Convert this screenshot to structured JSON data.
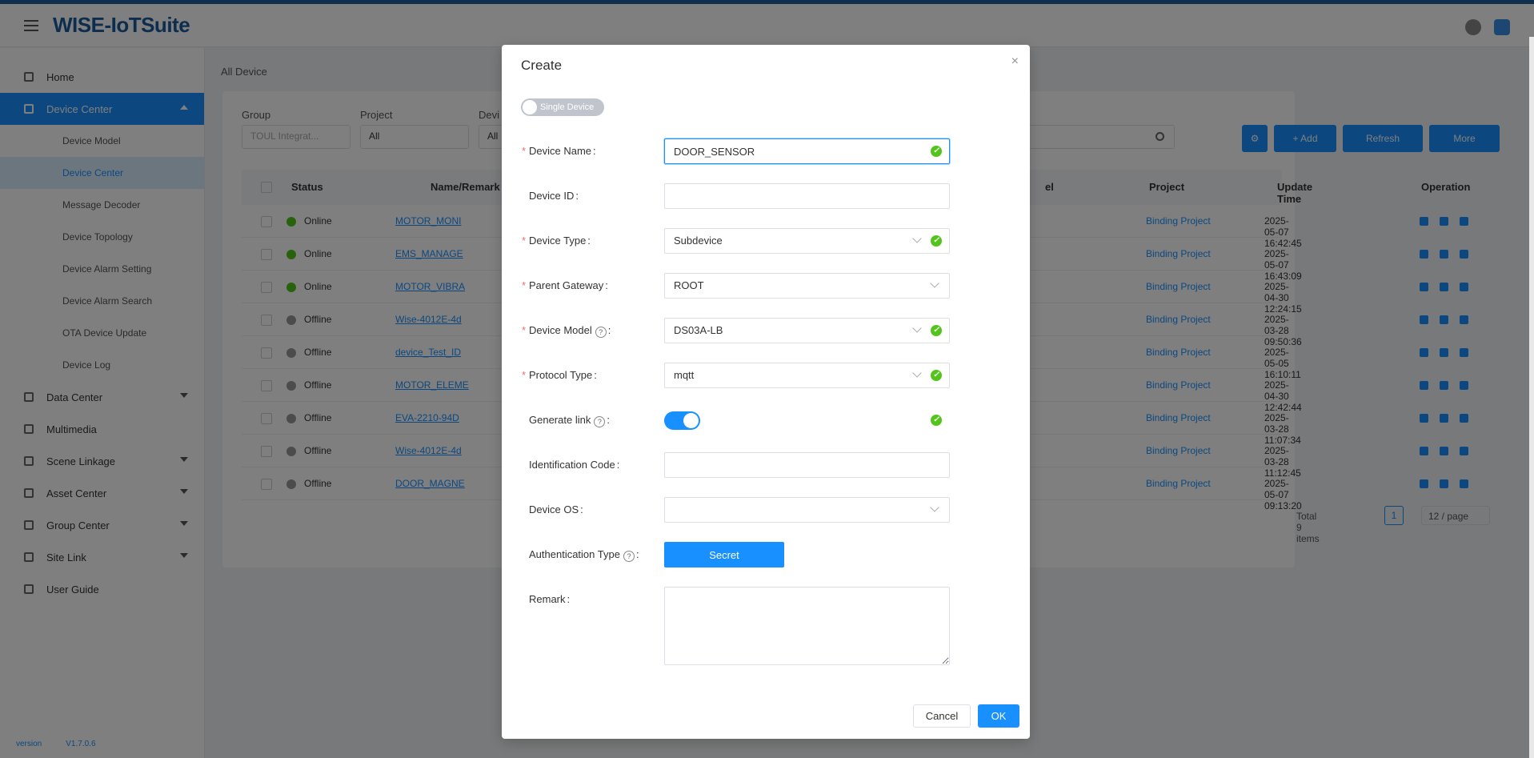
{
  "app": {
    "logo": "WISE-IoTSuite",
    "version": [
      "version",
      "V1.7.0.6"
    ]
  },
  "sidebar": {
    "items": [
      {
        "label": "Home",
        "icon": "home-icon"
      },
      {
        "label": "Device Center",
        "icon": "device-icon",
        "active": true
      },
      {
        "label": "Data Center",
        "icon": "data-icon"
      },
      {
        "label": "Multimedia",
        "icon": "multimedia-icon"
      },
      {
        "label": "Scene Linkage",
        "icon": "scene-icon"
      },
      {
        "label": "Asset Center",
        "icon": "asset-icon"
      },
      {
        "label": "Group Center",
        "icon": "group-icon"
      },
      {
        "label": "Site Link",
        "icon": "link-icon"
      },
      {
        "label": "User Guide",
        "icon": "guide-icon"
      }
    ],
    "sub_items": [
      "Device Model",
      "Device Center",
      "Message Decoder",
      "Device Topology",
      "Device Alarm Setting",
      "Device Alarm Search",
      "OTA Device Update",
      "Device Log"
    ]
  },
  "breadcrumb": "All Device",
  "filters": {
    "group_label": "Group",
    "group_placeholder": "TOUL Integrat...",
    "project_label": "Project",
    "project_value": "All",
    "device_label": "Devi",
    "device_value": "All"
  },
  "toolbar": {
    "add": "+ Add",
    "refresh": "Refresh",
    "more": "More"
  },
  "table": {
    "headers": {
      "status": "Status",
      "name": "Name/Remark",
      "model": "el",
      "project": "Project",
      "update_time": "Update Time",
      "operation": "Operation"
    },
    "rows": [
      {
        "status": "Online",
        "name": "MOTOR_MONI",
        "project": "Binding Project",
        "time": "2025-05-07 16:42:45"
      },
      {
        "status": "Online",
        "name": "EMS_MANAGE",
        "project": "Binding Project",
        "time": "2025-05-07 16:43:09"
      },
      {
        "status": "Online",
        "name": "MOTOR_VIBRA",
        "project": "Binding Project",
        "time": "2025-04-30 12:24:15"
      },
      {
        "status": "Offline",
        "name": "Wise-4012E-4d",
        "project": "Binding Project",
        "time": "2025-03-28 09:50:36"
      },
      {
        "status": "Offline",
        "name": "device_Test_ID",
        "project": "Binding Project",
        "time": "2025-05-05 16:10:11"
      },
      {
        "status": "Offline",
        "name": "MOTOR_ELEME",
        "project": "Binding Project",
        "time": "2025-04-30 12:42:44"
      },
      {
        "status": "Offline",
        "name": "EVA-2210-94D",
        "project": "Binding Project",
        "time": "2025-03-28 11:07:34"
      },
      {
        "status": "Offline",
        "name": "Wise-4012E-4d",
        "project": "Binding Project",
        "time": "2025-03-28 11:12:45"
      },
      {
        "status": "Offline",
        "name": "DOOR_MAGNE",
        "project": "Binding Project",
        "time": "2025-05-07 09:13:20"
      }
    ],
    "total": "Total 9 items",
    "page": "1",
    "page_size": "12 / page"
  },
  "colors": {
    "primary": "#1890ff",
    "online": "#52c41a",
    "offline": "#999999",
    "required": "#f56c6c"
  },
  "dialog": {
    "title": "Create",
    "mode_switch": "Single Device",
    "fields": {
      "device_name": {
        "label": "Device Name",
        "value": "DOOR_SENSOR"
      },
      "device_id": {
        "label": "Device ID",
        "value": ""
      },
      "device_type": {
        "label": "Device Type",
        "value": "Subdevice"
      },
      "parent_gateway": {
        "label": "Parent Gateway",
        "value": "ROOT"
      },
      "device_model": {
        "label": "Device Model",
        "value": "DS03A-LB"
      },
      "protocol_type": {
        "label": "Protocol Type",
        "value": "mqtt"
      },
      "generate_link": {
        "label": "Generate link",
        "on": true
      },
      "identification_code": {
        "label": "Identification Code",
        "value": ""
      },
      "device_os": {
        "label": "Device OS",
        "value": ""
      },
      "authentication_type": {
        "label": "Authentication Type",
        "value": "Secret"
      },
      "remark": {
        "label": "Remark",
        "value": ""
      }
    },
    "colon": ":",
    "required_mark": "*",
    "help_mark": "?",
    "check_mark": "✓",
    "close_glyph": "×",
    "cancel": "Cancel",
    "ok": "OK"
  }
}
